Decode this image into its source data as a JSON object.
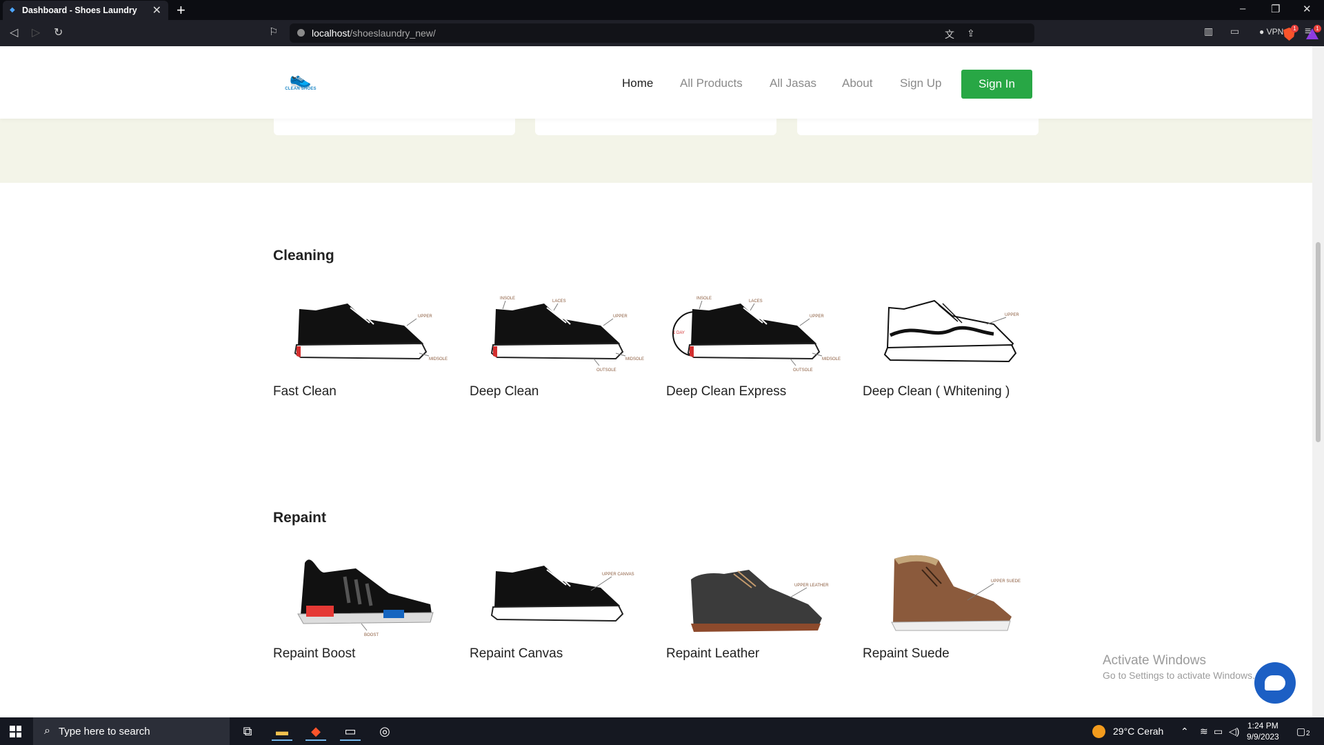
{
  "browser": {
    "tab_title": "Dashboard - Shoes Laundry",
    "url_host": "localhost",
    "url_path": "/shoeslaundry_new/",
    "vpn_label": "VPN",
    "shield_badge": "1",
    "rewards_badge": "1"
  },
  "navbar": {
    "logo_text": "CLEAN SHOES",
    "menu": [
      "Home",
      "All Products",
      "All Jasas",
      "About",
      "Sign Up"
    ],
    "signin_label": "Sign In",
    "accent": "#28a745"
  },
  "sections": [
    {
      "title": "Cleaning",
      "items": [
        {
          "name": "Fast Clean",
          "labels": [
            "UPPER",
            "MIDSOLE"
          ]
        },
        {
          "name": "Deep Clean",
          "labels": [
            "INSOLE",
            "LACES",
            "UPPER",
            "MIDSOLE",
            "OUTSOLE"
          ]
        },
        {
          "name": "Deep Clean Express",
          "labels": [
            "1 DAY",
            "INSOLE",
            "LACES",
            "UPPER",
            "MIDSOLE",
            "OUTSOLE"
          ]
        },
        {
          "name": "Deep Clean ( Whitening )",
          "labels": [
            "UPPER"
          ]
        }
      ]
    },
    {
      "title": "Repaint",
      "items": [
        {
          "name": "Repaint Boost",
          "labels": [
            "BOOST"
          ]
        },
        {
          "name": "Repaint Canvas",
          "labels": [
            "UPPER CANVAS"
          ]
        },
        {
          "name": "Repaint Leather",
          "labels": [
            "UPPER LEATHER"
          ]
        },
        {
          "name": "Repaint Suede",
          "labels": [
            "UPPER SUEDE"
          ]
        }
      ]
    }
  ],
  "watermark": {
    "line1": "Activate Windows",
    "line2": "Go to Settings to activate Windows."
  },
  "taskbar": {
    "search_placeholder": "Type here to search",
    "weather": "29°C  Cerah",
    "time": "1:24 PM",
    "date": "9/9/2023",
    "notifications": "2"
  }
}
